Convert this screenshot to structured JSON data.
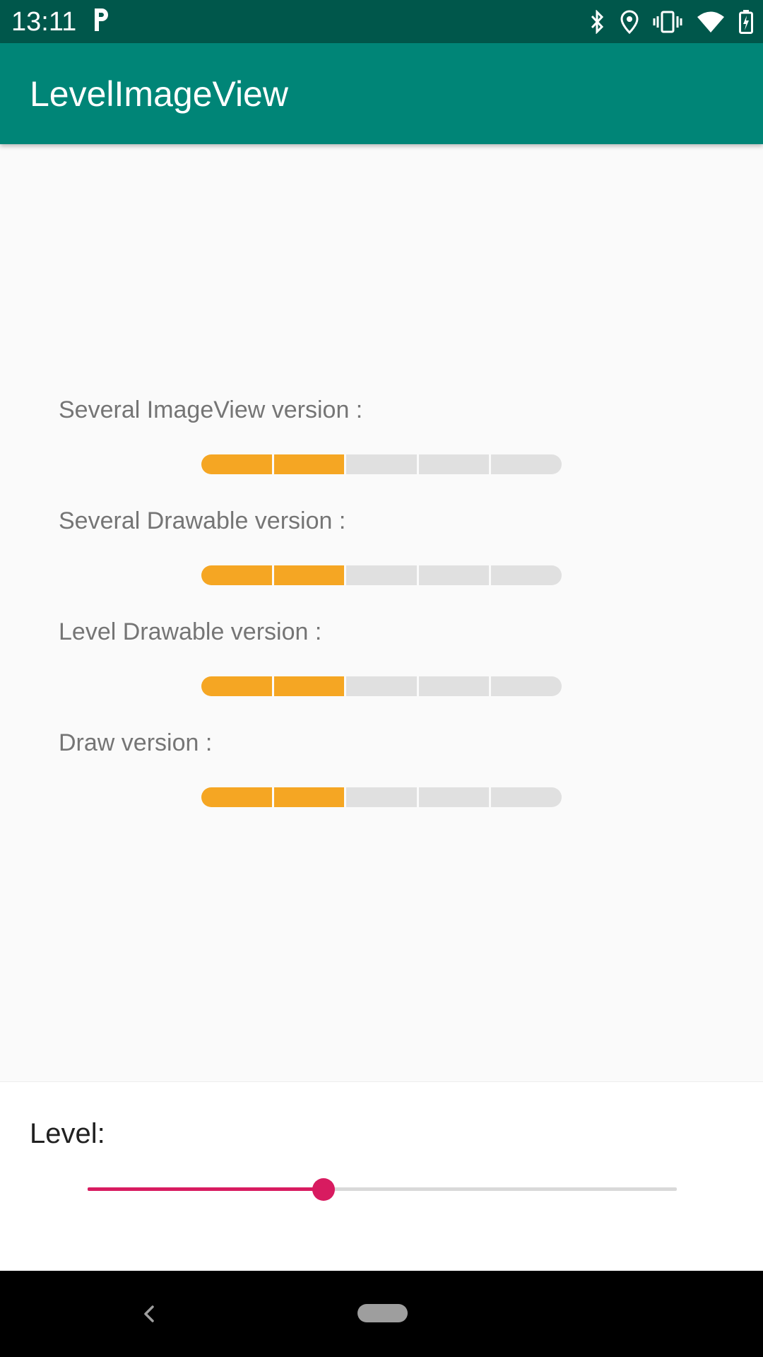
{
  "status_bar": {
    "time": "13:11",
    "icons": [
      "parking-icon",
      "bluetooth-icon",
      "location-icon",
      "vibrate-icon",
      "wifi-icon",
      "battery-icon"
    ]
  },
  "app_bar": {
    "title": "LevelImageView"
  },
  "sections": [
    {
      "label": "Several ImageView version :",
      "segments_total": 5,
      "segments_on": 2
    },
    {
      "label": "Several Drawable version :",
      "segments_total": 5,
      "segments_on": 2
    },
    {
      "label": "Level Drawable version :",
      "segments_total": 5,
      "segments_on": 2
    },
    {
      "label": "Draw version :",
      "segments_total": 5,
      "segments_on": 2
    }
  ],
  "level_control": {
    "heading": "Level:",
    "value_fraction": 0.4
  },
  "colors": {
    "status_bar": "#00574b",
    "app_bar": "#008577",
    "level_on": "#f5a623",
    "level_off": "#e0e0e0",
    "accent": "#d81b60"
  }
}
